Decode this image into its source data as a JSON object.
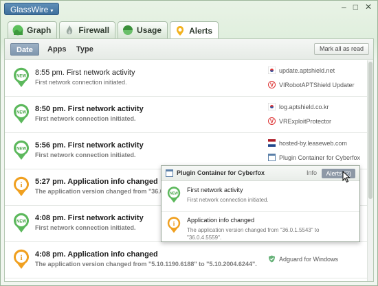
{
  "app": {
    "title": "GlassWire",
    "menu_caret": "▾"
  },
  "window_controls": [
    "–",
    "□",
    "✕"
  ],
  "tabs": [
    {
      "label": "Graph",
      "icon": "graph-icon",
      "active": false
    },
    {
      "label": "Firewall",
      "icon": "firewall-icon",
      "active": false
    },
    {
      "label": "Usage",
      "icon": "usage-icon",
      "active": false
    },
    {
      "label": "Alerts",
      "icon": "alerts-icon",
      "active": true
    }
  ],
  "subtabs": [
    {
      "label": "Date",
      "active": true
    },
    {
      "label": "Apps",
      "active": false
    },
    {
      "label": "Type",
      "active": false
    }
  ],
  "mark_all_read": "Mark all as read",
  "alerts": [
    {
      "kind": "new",
      "title": "8:55 pm. First network activity",
      "desc": "First network connection initiated.",
      "bold": false,
      "meta": [
        {
          "icon": "korea-flag-icon",
          "text": "update.aptshield.net"
        },
        {
          "icon": "virobot-app-icon",
          "text": "VIRobotAPTShield Updater"
        }
      ]
    },
    {
      "kind": "new",
      "title": "8:50 pm. First network activity",
      "desc": "First network connection initiated.",
      "bold": true,
      "meta": [
        {
          "icon": "korea-flag-icon",
          "text": "log.aptshield.co.kr"
        },
        {
          "icon": "virobot-app-icon",
          "text": "VRExploitProtector"
        }
      ]
    },
    {
      "kind": "new",
      "title": "5:56 pm. First network activity",
      "desc": "First network connection initiated.",
      "bold": true,
      "meta": [
        {
          "icon": "netherlands-flag-icon",
          "text": "hosted-by.leaseweb.com"
        },
        {
          "icon": "app-window-icon",
          "text": "Plugin Container for Cyberfox"
        }
      ]
    },
    {
      "kind": "info",
      "title": "5:27 pm. Application info changed",
      "desc": "The application version changed from \"36.0",
      "bold": true,
      "meta": []
    },
    {
      "kind": "new",
      "title": "4:08 pm. First network activity",
      "desc": "First network connection initiated.",
      "bold": true,
      "meta": []
    },
    {
      "kind": "info",
      "title": "4:08 pm. Application info changed",
      "desc": "The application version changed from \"5.10.1190.6188\" to \"5.10.2004.6244\".",
      "bold": true,
      "meta": [
        {
          "icon": "adguard-icon",
          "text": "Adguard for Windows"
        }
      ]
    }
  ],
  "popup": {
    "title": "Plugin Container for Cyberfox",
    "info_label": "Info",
    "alerts_label": "Alerts (2)",
    "items": [
      {
        "kind": "new",
        "title": "First network activity",
        "desc": "First network connection initiated."
      },
      {
        "kind": "info",
        "title": "Application info changed",
        "desc": "The application version changed from \"36.0.1.5543\" to \"36.0.4.5559\"."
      }
    ]
  },
  "badge_text": {
    "new": "NEW",
    "info": "i"
  },
  "colors": {
    "new_badge": "#5cb85c",
    "info_badge": "#f0a020",
    "accent_blue": "#3e6f9c"
  }
}
